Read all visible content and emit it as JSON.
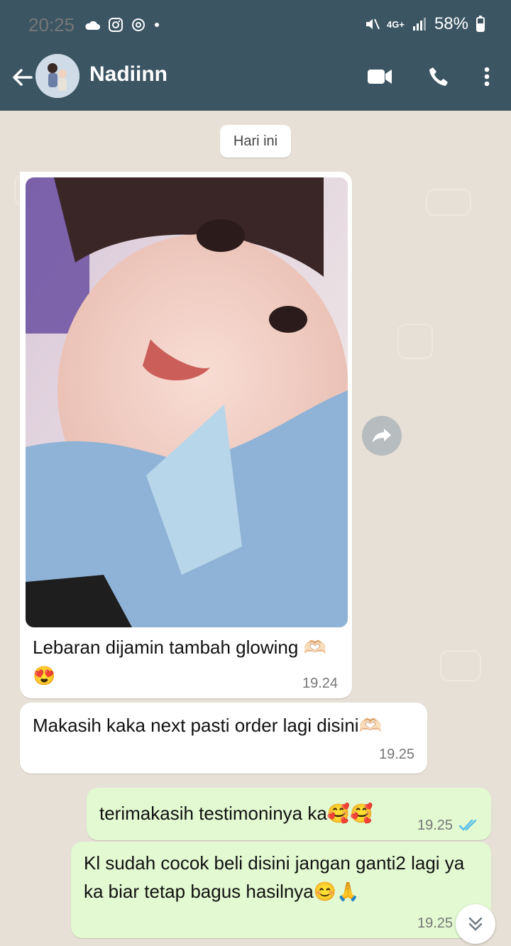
{
  "status_bar": {
    "time": "20:25",
    "network": "4G+",
    "battery": "58%"
  },
  "header": {
    "contact_name": "Nadiinn"
  },
  "chat": {
    "date_chip": "Hari ini",
    "messages": [
      {
        "type": "incoming-photo",
        "caption": "Lebaran dijamin tambah glowing 🫶🏻😍",
        "time": "19.24"
      },
      {
        "type": "incoming",
        "text": "Makasih kaka next pasti order lagi disini🫶🏻",
        "time": "19.25"
      },
      {
        "type": "outgoing",
        "text": "terimakasih testimoninya ka🥰🥰",
        "time": "19.25"
      },
      {
        "type": "outgoing",
        "text": "Kl sudah cocok beli disini jangan ganti2 lagi ya ka biar tetap bagus hasilnya😊🙏",
        "time": "19.25"
      }
    ]
  },
  "icons": {
    "back": "arrow-left-icon",
    "video": "video-call-icon",
    "phone": "phone-icon",
    "more": "more-vert-icon",
    "forward": "forward-icon",
    "scroll_down": "double-chevron-down-icon"
  },
  "colors": {
    "header": "#3b5563",
    "outgoing_bubble": "#e2f9d1",
    "incoming_bubble": "#ffffff",
    "tick_blue": "#53bdeb"
  }
}
